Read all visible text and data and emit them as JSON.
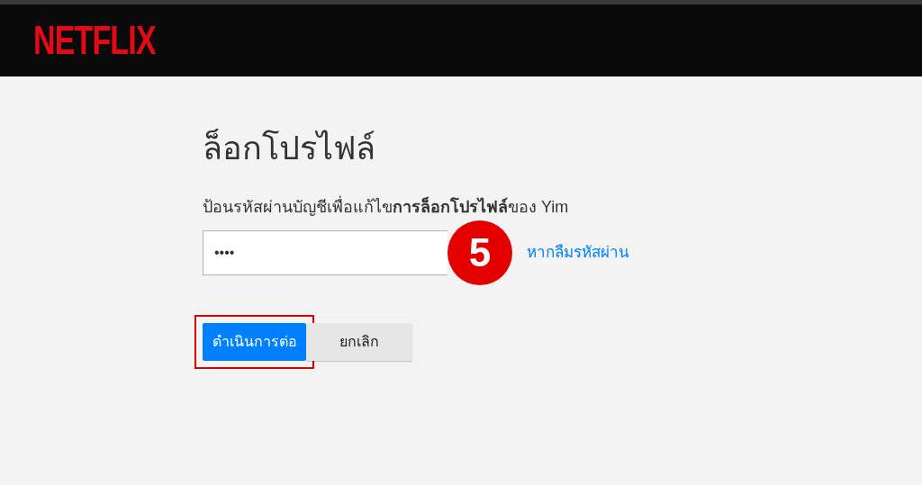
{
  "header": {
    "logo": "NETFLIX"
  },
  "title": "ล็อกโปรไฟล์",
  "instruction": "ป้อนรหัสผ่านบัญชีเพื่อแก้ไข**การล็อกโปรไฟล์**ของ Yim",
  "password": {
    "value": "••••"
  },
  "step_badge": "5",
  "forgot_link": "หากลืมรหัสผ่าน",
  "buttons": [
    {
      "label": "ดำเนินการต่อ",
      "kind": "primary",
      "highlighted": true
    },
    {
      "label": "ยกเลิก",
      "kind": "secondary",
      "highlighted": false
    }
  ]
}
